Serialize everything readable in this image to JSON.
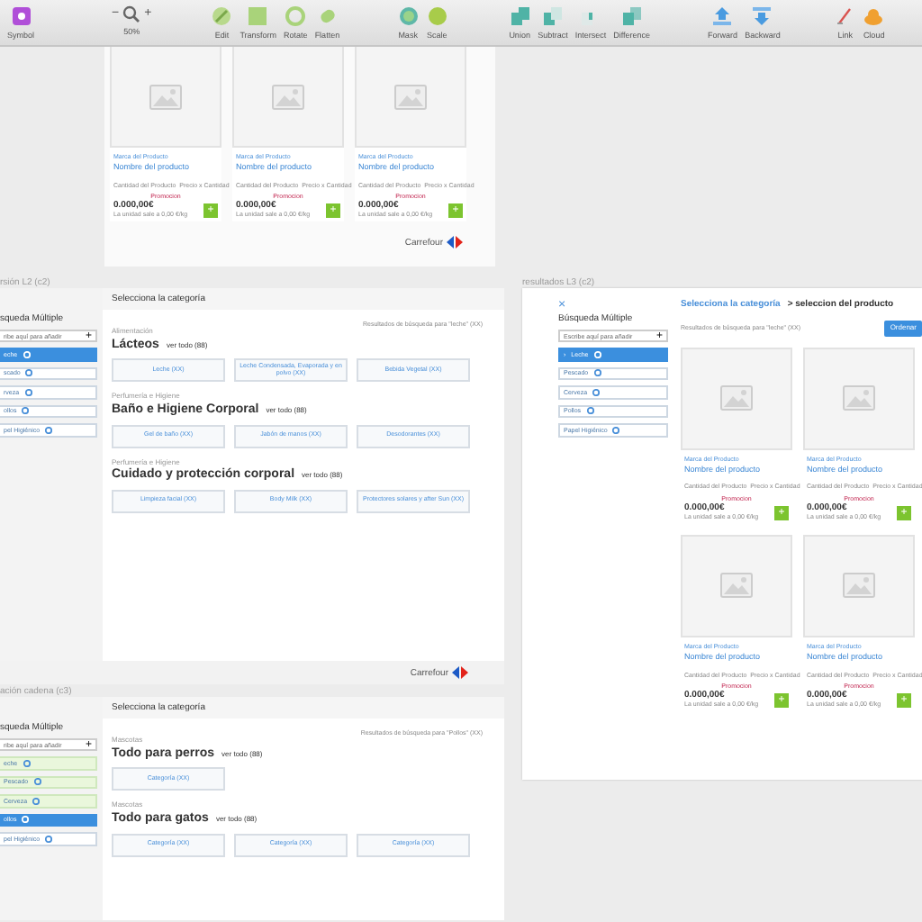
{
  "toolbar": [
    [
      {
        "kind": "symbol",
        "label": "Symbol"
      }
    ],
    [
      {
        "kind": "zoom",
        "label": "50%",
        "minus": "−",
        "plus": "+"
      }
    ],
    [
      {
        "kind": "edit",
        "label": "Edit"
      },
      {
        "kind": "transform",
        "label": "Transform"
      },
      {
        "kind": "rotate",
        "label": "Rotate"
      },
      {
        "kind": "flatten",
        "label": "Flatten"
      }
    ],
    [
      {
        "kind": "mask",
        "label": "Mask"
      },
      {
        "kind": "scale",
        "label": "Scale"
      }
    ],
    [
      {
        "kind": "union",
        "label": "Union"
      },
      {
        "kind": "subtract",
        "label": "Subtract"
      },
      {
        "kind": "intersect",
        "label": "Intersect"
      },
      {
        "kind": "difference",
        "label": "Difference"
      }
    ],
    [
      {
        "kind": "forward",
        "label": "Forward"
      },
      {
        "kind": "backward",
        "label": "Backward"
      }
    ],
    [
      {
        "kind": "link",
        "label": "Link"
      },
      {
        "kind": "cloud",
        "label": "Cloud"
      }
    ]
  ],
  "product_artboard": {
    "products": [
      {
        "brand": "Marca del Producto",
        "name": "Nombre del producto",
        "spec_left": "Cantidad del Producto",
        "spec_right": "Precio x Cantidad",
        "promo": "Promocion",
        "price": "0.000,00€",
        "unit_price": "La unidad sale a 0,00 €/kg",
        "add": "+"
      },
      {
        "brand": "Marca del Producto",
        "name": "Nombre del producto",
        "spec_left": "Cantidad del Producto",
        "spec_right": "Precio x Cantidad",
        "promo": "Promocion",
        "price": "0.000,00€",
        "unit_price": "La unidad sale a 0,00 €/kg",
        "add": "+"
      },
      {
        "brand": "Marca del Producto",
        "name": "Nombre del producto",
        "spec_left": "Cantidad del Producto",
        "spec_right": "Precio x Cantidad",
        "promo": "Promocion",
        "price": "0.000,00€",
        "unit_price": "La unidad sale a 0,00 €/kg",
        "add": "+"
      }
    ],
    "footer": "Carrefour"
  },
  "category_artboards": [
    {
      "label": "rsión L2 (c2)",
      "sidebar": {
        "title": "squeda Múltiple",
        "placeholder": "ribe aquí para añadir",
        "add": "+",
        "chips": [
          {
            "label": "eche",
            "selected": true,
            "matched": false
          },
          {
            "label": "scado",
            "selected": false,
            "matched": false
          },
          {
            "label": "rveza",
            "selected": false,
            "matched": false
          },
          {
            "label": "ollos",
            "selected": false,
            "matched": false
          },
          {
            "label": "pel Higiénico",
            "selected": false,
            "matched": false
          }
        ]
      },
      "header": "Selecciona la categoría",
      "results": "Resultados de búsqueda para \"leche\" (XX)",
      "sections": [
        {
          "overline": "Alimentación",
          "title": "Lácteos",
          "link": "ver todo (88)",
          "categories": [
            "Leche (XX)",
            "Leche Condensada, Evaporada y en polvo (XX)",
            "Bebida Vegetal (XX)"
          ]
        },
        {
          "overline": "Perfumería e Higiene",
          "title": "Baño e Higiene Corporal",
          "link": "ver todo (88)",
          "categories": [
            "Gel de baño (XX)",
            "Jabón de manos (XX)",
            "Desodorantes (XX)"
          ]
        },
        {
          "overline": "Perfumería e Higiene",
          "title": "Cuidado y protección corporal",
          "link": "ver todo (88)",
          "categories": [
            "Limpieza facial (XX)",
            "Body Milk (XX)",
            "Protectores solares y after Sun (XX)"
          ]
        }
      ],
      "footer": "Carrefour"
    },
    {
      "label": "ación cadena (c3)",
      "sidebar": {
        "title": "squeda Múltiple",
        "placeholder": "ribe aquí para añadir",
        "add": "+",
        "chips": [
          {
            "label": "eche",
            "selected": false,
            "matched": true
          },
          {
            "label": "Pescado",
            "selected": false,
            "matched": true
          },
          {
            "label": "Cerveza",
            "selected": false,
            "matched": true
          },
          {
            "label": "ollos",
            "selected": true,
            "matched": false
          },
          {
            "label": "pel Higiénico",
            "selected": false,
            "matched": false
          }
        ]
      },
      "header": "Selecciona la categoría",
      "results": "Resultados de búsqueda para \"Pollos\" (XX)",
      "sections": [
        {
          "overline": "Mascotas",
          "title": "Todo para perros",
          "link": "ver todo (88)",
          "categories": [
            "Categoría (XX)"
          ]
        },
        {
          "overline": "Mascotas",
          "title": "Todo para gatos",
          "link": "ver todo (88)",
          "categories": [
            "Categoría (XX)",
            "Categoría (XX)",
            "Categoría (XX)"
          ]
        }
      ]
    }
  ],
  "results_artboard": {
    "label": "resultados L3 (c2)",
    "close": "×",
    "sidebar": {
      "title": "Búsqueda Múltiple",
      "placeholder": "Escribe aquí para añadir",
      "add": "+",
      "chips": [
        {
          "label": "Leche",
          "prefix": "›",
          "selected": true,
          "matched": false
        },
        {
          "label": "Pescado",
          "selected": false,
          "matched": false
        },
        {
          "label": "Cerveza",
          "selected": false,
          "matched": false
        },
        {
          "label": "Pollos",
          "selected": false,
          "matched": false
        },
        {
          "label": "Papel Higiénico",
          "selected": false,
          "matched": false
        }
      ]
    },
    "breadcrumb": {
      "link": "Selecciona la categoría",
      "current": "> seleccion del producto"
    },
    "results": "Resultados de búsqueda para \"leche\" (XX)",
    "sort_button": "Ordenar",
    "products": [
      {
        "brand": "Marca del Producto",
        "name": "Nombre del producto",
        "spec_left": "Cantidad del Producto",
        "spec_right": "Precio x Cantidad",
        "promo": "Promocion",
        "price": "0.000,00€",
        "unit_price": "La unidad sale a 0,00 €/kg",
        "add": "+"
      },
      {
        "brand": "Marca del Producto",
        "name": "Nombre del producto",
        "spec_left": "Cantidad del Producto",
        "spec_right": "Precio x Cantidad",
        "promo": "Promocion",
        "price": "0.000,00€",
        "unit_price": "La unidad sale a 0,00 €/kg",
        "add": "+"
      },
      {
        "brand": "Marca del Producto",
        "name": "Nombre del producto",
        "spec_left": "Cantidad del Producto",
        "spec_right": "Precio x Cantidad",
        "promo": "Promocion",
        "price": "0.000,00€",
        "unit_price": "La unidad sale a 0,00 €/kg",
        "add": "+"
      },
      {
        "brand": "Marca del Producto",
        "name": "Nombre del producto",
        "spec_left": "Cantidad del Producto",
        "spec_right": "Precio x Cantidad",
        "promo": "Promocion",
        "price": "0.000,00€",
        "unit_price": "La unidad sale a 0,00 €/kg",
        "add": "+"
      }
    ]
  }
}
